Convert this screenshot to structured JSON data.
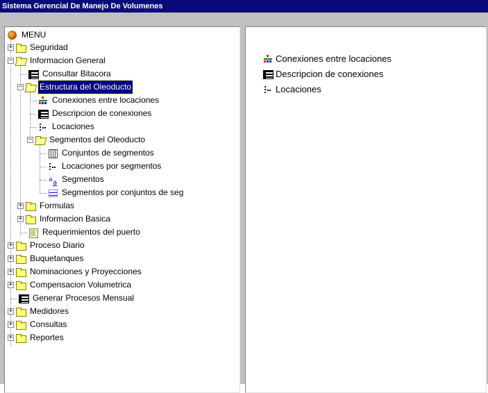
{
  "window": {
    "title": "Sistema Gerencial De Manejo De Volumenes"
  },
  "tree": {
    "root": "MENU",
    "seguridad": "Seguridad",
    "informacion_general": "Informacion General",
    "consultar_bitacora": "Consultar Bitacora",
    "estructura_oleoducto": "Estructura del Oleoducto",
    "conexiones_entre_locaciones": "Conexiones entre locaciones",
    "descripcion_conexiones": "Descripcion de conexiones",
    "locaciones": "Locaciones",
    "segmentos_oleoducto": "Segmentos del Oleoducto",
    "conjuntos_segmentos": "Conjuntos de segmentos",
    "locaciones_por_segmentos": "Locaciones por segmentos",
    "segmentos": "Segmentos",
    "segmentos_por_conjuntos": "Segmentos por conjuntos de seg",
    "formulas": "Formulas",
    "informacion_basica": "Informacion Basica",
    "requerimientos_puerto": "Requerimientos del puerto",
    "proceso_diario": "Proceso Diario",
    "buquetanques": "Buquetanques",
    "nominaciones": "Nominaciones y Proyecciones",
    "compensacion": "Compensacion Volumetrica",
    "generar_procesos": "Generar Procesos Mensual",
    "medidores": "Medidores",
    "consultas": "Consultas",
    "reportes": "Reportes"
  },
  "detail": {
    "items": [
      "Conexiones entre locaciones",
      "Descripcion de conexiones",
      "Locaciones"
    ]
  },
  "colors": {
    "titlebar": "#0a0a7a",
    "selection": "#000080",
    "chrome": "#c0c0c0"
  }
}
